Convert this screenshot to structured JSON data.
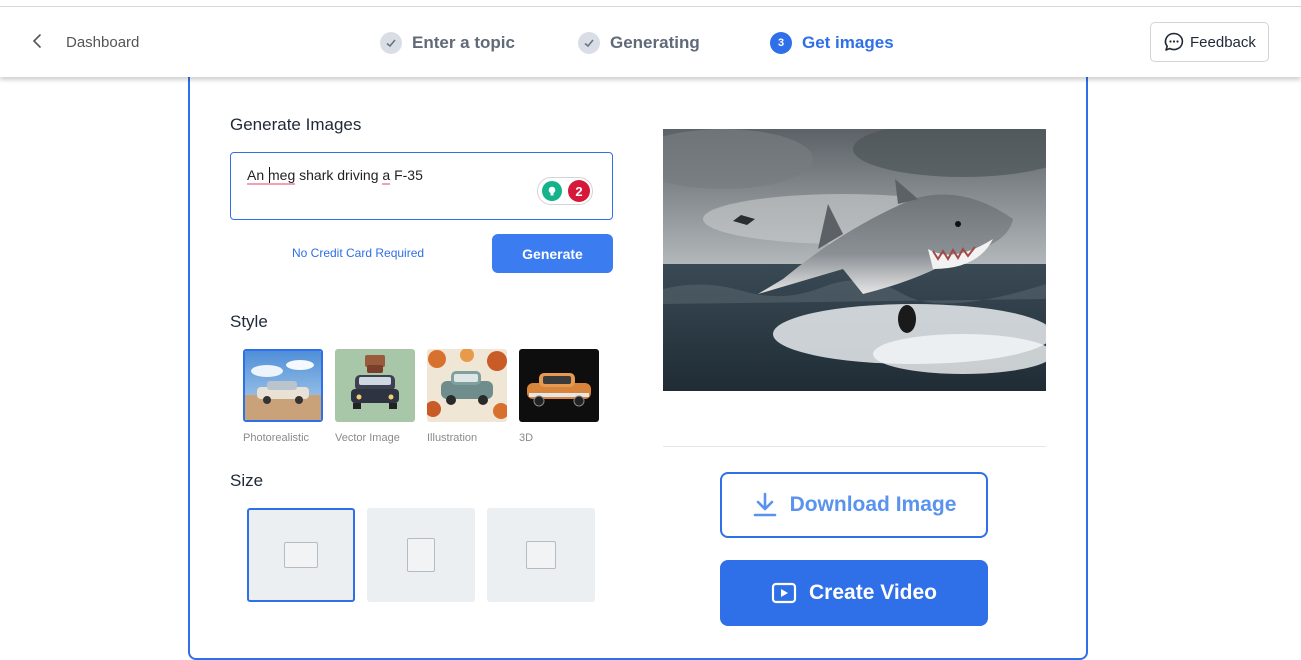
{
  "nav": {
    "back_label": "Dashboard",
    "steps": [
      {
        "number": "1",
        "label": "Enter a topic",
        "state": "done"
      },
      {
        "number": "2",
        "label": "Generating",
        "state": "done"
      },
      {
        "number": "3",
        "label": "Get images",
        "state": "active"
      }
    ],
    "feedback_label": "Feedback"
  },
  "generate": {
    "title": "Generate Images",
    "prompt_parts": [
      "An",
      " meg",
      " shark driving ",
      "a",
      " F-35"
    ],
    "grammar_count": "2",
    "no_credit": "No Credit Card Required",
    "button_label": "Generate"
  },
  "style": {
    "title": "Style",
    "options": [
      {
        "label": "Photorealistic",
        "selected": true
      },
      {
        "label": "Vector Image",
        "selected": false
      },
      {
        "label": "Illustration",
        "selected": false
      },
      {
        "label": "3D",
        "selected": false
      }
    ]
  },
  "size": {
    "title": "Size",
    "options": [
      {
        "shape": "landscape",
        "selected": true
      },
      {
        "shape": "portrait",
        "selected": false
      },
      {
        "shape": "square",
        "selected": false
      }
    ]
  },
  "result": {
    "download_label": "Download Image",
    "create_video_label": "Create Video"
  },
  "colors": {
    "accent": "#2f6fe8",
    "grammar_red": "#d6183a",
    "grammar_green": "#15b38b"
  }
}
